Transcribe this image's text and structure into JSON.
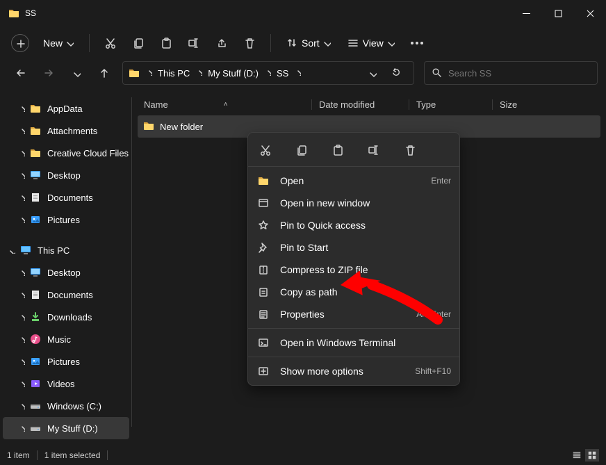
{
  "window": {
    "title": "SS"
  },
  "toolbar": {
    "new_label": "New",
    "sort_label": "Sort",
    "view_label": "View"
  },
  "breadcrumbs": [
    "This PC",
    "My Stuff (D:)",
    "SS"
  ],
  "search": {
    "placeholder": "Search SS"
  },
  "sidebar": {
    "quick": [
      {
        "label": "AppData",
        "icon": "folder"
      },
      {
        "label": "Attachments",
        "icon": "folder"
      },
      {
        "label": "Creative Cloud Files",
        "icon": "folder"
      },
      {
        "label": "Desktop",
        "icon": "desktop"
      },
      {
        "label": "Documents",
        "icon": "documents"
      },
      {
        "label": "Pictures",
        "icon": "pictures"
      }
    ],
    "thispc_label": "This PC",
    "thispc": [
      {
        "label": "Desktop",
        "icon": "desktop"
      },
      {
        "label": "Documents",
        "icon": "documents"
      },
      {
        "label": "Downloads",
        "icon": "downloads"
      },
      {
        "label": "Music",
        "icon": "music"
      },
      {
        "label": "Pictures",
        "icon": "pictures"
      },
      {
        "label": "Videos",
        "icon": "videos"
      },
      {
        "label": "Windows (C:)",
        "icon": "drive"
      },
      {
        "label": "My Stuff (D:)",
        "icon": "drive"
      }
    ]
  },
  "columns": {
    "name": "Name",
    "date": "Date modified",
    "type": "Type",
    "size": "Size"
  },
  "files": [
    {
      "name": "New folder",
      "icon": "folder"
    }
  ],
  "context_menu": {
    "items": [
      {
        "label": "Open",
        "icon": "folder",
        "shortcut": "Enter"
      },
      {
        "label": "Open in new window",
        "icon": "window"
      },
      {
        "label": "Pin to Quick access",
        "icon": "star"
      },
      {
        "label": "Pin to Start",
        "icon": "pin"
      },
      {
        "label": "Compress to ZIP file",
        "icon": "zip"
      },
      {
        "label": "Copy as path",
        "icon": "copypath"
      },
      {
        "label": "Properties",
        "icon": "properties",
        "shortcut": "Alt+Enter"
      }
    ],
    "terminal": {
      "label": "Open in Windows Terminal",
      "icon": "terminal"
    },
    "more": {
      "label": "Show more options",
      "icon": "more",
      "shortcut": "Shift+F10"
    }
  },
  "status": {
    "count": "1 item",
    "selected": "1 item selected"
  }
}
